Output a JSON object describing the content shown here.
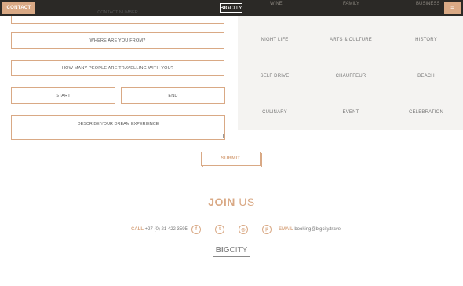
{
  "header": {
    "contact_label": "CONTACT",
    "logo_bold": "BIG",
    "logo_light": "CITY",
    "menu_icon": "hamburger-icon",
    "menu_glyph": "≡",
    "partial_nav": [
      "WINE",
      "FAMILY",
      "BUSINESS"
    ]
  },
  "form": {
    "contact_number_placeholder": "CONTACT NUMBER",
    "where_from_placeholder": "WHERE ARE YOU FROM?",
    "people_placeholder": "HOW MANY PEOPLE ARE TRAVELLING WITH YOU?",
    "start_placeholder": "START",
    "end_placeholder": "END",
    "experience_placeholder": "DESCRIBE YOUR DREAM EXPERIENCE",
    "submit_label": "SUBMIT"
  },
  "categories": [
    [
      "NIGHT LIFE",
      "ARTS & CULTURE",
      "HISTORY"
    ],
    [
      "SELF DRIVE",
      "CHAUFFEUR",
      "BEACH"
    ],
    [
      "CULINARY",
      "EVENT",
      "CELEBRATION"
    ]
  ],
  "footer": {
    "join_bold": "JOIN",
    "join_light": "US",
    "call_label": "CALL",
    "call_value": "+27 (0) 21 422 3595",
    "email_label": "EMAIL",
    "email_value": "booking@bigcity.travel",
    "social_icons": [
      "facebook-icon",
      "twitter-icon",
      "instagram-icon",
      "pinterest-icon"
    ],
    "social_glyphs": [
      "f",
      "t",
      "◎",
      "p"
    ],
    "logo_bold": "BIG",
    "logo_light": "CITY"
  },
  "colors": {
    "accent": "#d9a985",
    "topbar": "#2b2926",
    "panel": "#f4f3f1"
  }
}
